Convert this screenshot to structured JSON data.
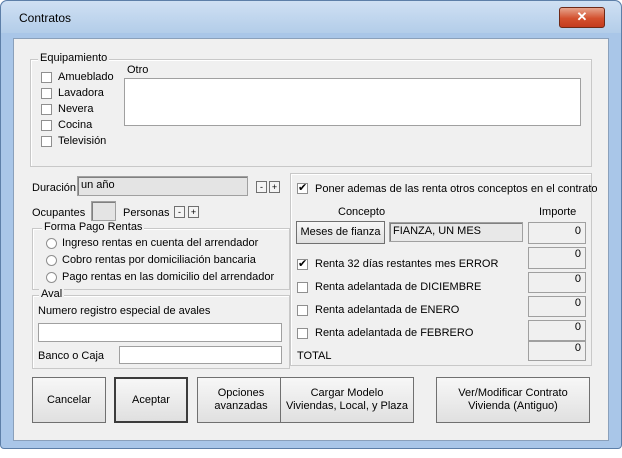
{
  "window": {
    "title": "Contratos",
    "close_glyph": "✕"
  },
  "equipamiento": {
    "legend": "Equipamiento",
    "items": [
      "Amueblado",
      "Lavadora",
      "Nevera",
      "Cocina",
      "Televisión"
    ],
    "otro_label": "Otro",
    "otro_value": ""
  },
  "duracion": {
    "label": "Duración",
    "value": "un año",
    "minus": "-",
    "plus": "+"
  },
  "ocupantes": {
    "label": "Ocupantes",
    "value": "",
    "unit": "Personas",
    "minus": "-",
    "plus": "+"
  },
  "forma_pago": {
    "legend": "Forma Pago Rentas",
    "options": [
      "Ingreso rentas en cuenta del arrendador",
      "Cobro rentas por domiciliación bancaria",
      "Pago rentas en las domicilio del arrendador"
    ]
  },
  "aval": {
    "legend": "Aval",
    "registro_label": "Numero registro especial de avales",
    "registro_value": "",
    "banco_label": "Banco o Caja",
    "banco_value": ""
  },
  "conceptos": {
    "header_label": "Poner ademas de las renta otros conceptos en el contrato",
    "header_checked": true,
    "col_concepto": "Concepto",
    "col_importe": "Importe",
    "meses_button": "Meses de fianza",
    "fianza_text": "FIANZA, UN MES",
    "fianza_amount": "0",
    "rows": [
      {
        "label": "Renta 32 días restantes mes ERROR",
        "checked": true,
        "amount": "0"
      },
      {
        "label": "Renta adelantada de DICIEMBRE",
        "checked": false,
        "amount": "0"
      },
      {
        "label": "Renta adelantada de ENERO",
        "checked": false,
        "amount": "0"
      },
      {
        "label": "Renta adelantada de FEBRERO",
        "checked": false,
        "amount": "0"
      }
    ],
    "total_label": "TOTAL",
    "total_amount": "0"
  },
  "buttons": {
    "cancelar": "Cancelar",
    "aceptar": "Aceptar",
    "opciones_l1": "Opciones",
    "opciones_l2": "avanzadas",
    "cargar_l1": "Cargar Modelo",
    "cargar_l2": "Viviendas, Local, y Plaza",
    "vermod_l1": "Ver/Modificar Contrato",
    "vermod_l2": "Vivienda (Antiguo)"
  }
}
